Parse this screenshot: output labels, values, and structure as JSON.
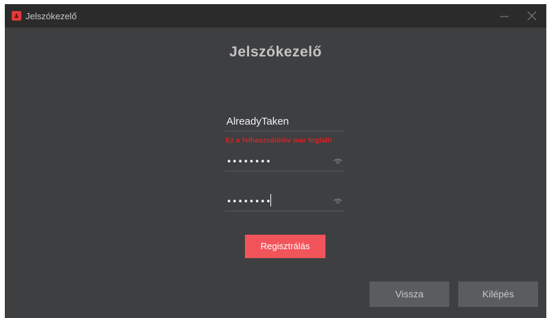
{
  "window": {
    "title": "Jelszókezelő",
    "app_icon": "app-logo-icon",
    "minimize_icon": "minimize-icon",
    "close_icon": "close-icon"
  },
  "main": {
    "heading": "Jelszókezelő",
    "username": {
      "value": "AlreadyTaken"
    },
    "error_message": "Ez a felhasználólév már foglalt!",
    "password": {
      "masked_value": "••••••••",
      "toggle_icon": "eye-icon"
    },
    "password_confirm": {
      "masked_value": "••••••••",
      "toggle_icon": "eye-icon"
    },
    "register_label": "Regisztrálás"
  },
  "footer": {
    "back_label": "Vissza",
    "exit_label": "Kilépés"
  },
  "colors": {
    "background": "#3e3f41",
    "titlebar": "#2b2b2b",
    "accent": "#f2545b",
    "error": "#e02020",
    "secondary_button": "#5b5c5e"
  }
}
